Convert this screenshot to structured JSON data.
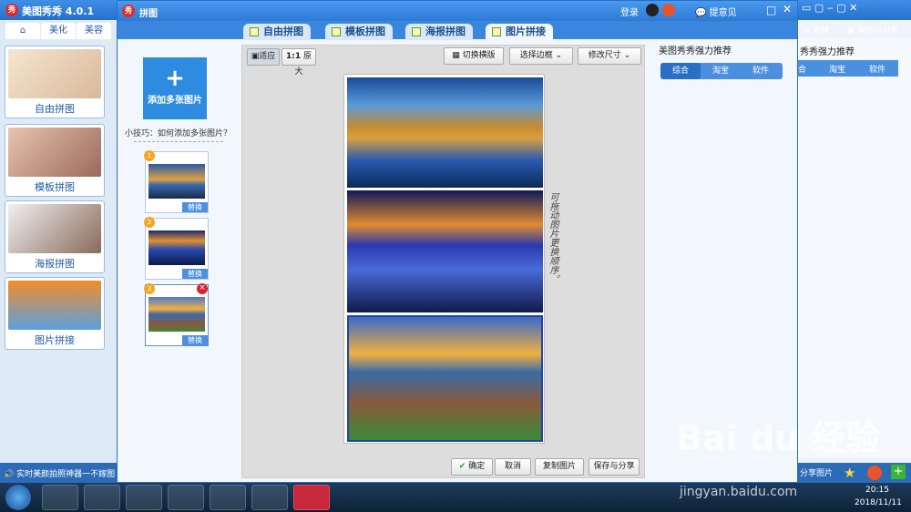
{
  "app": {
    "title": "美图秀秀 4.0.1",
    "sub_title": "拼图"
  },
  "left_tabs": [
    "美化",
    "美容"
  ],
  "left_cards": [
    {
      "label": "自由拼图"
    },
    {
      "label": "模板拼图"
    },
    {
      "label": "海报拼图"
    },
    {
      "label": "图片拼接"
    }
  ],
  "left_status": "实时美颜拍照神器一不嫁图",
  "header": {
    "login": "登录",
    "feedback": "提意见"
  },
  "tabs": [
    {
      "label": "自由拼图"
    },
    {
      "label": "模板拼图"
    },
    {
      "label": "海报拼图"
    },
    {
      "label": "图片拼接"
    }
  ],
  "left_panel": {
    "add_button": "添加多张图片",
    "tip": "小技巧：如何添加多张图片？",
    "replace_label": "替换",
    "thumbs": [
      "1",
      "2",
      "3"
    ]
  },
  "toolbar": {
    "fit": "适应",
    "original_ratio": "1:1",
    "original": "原大",
    "switch": "切换横版",
    "border": "选择边框",
    "resize": "修改尺寸"
  },
  "hint": "可拖动图片更换顺序。",
  "bottom_buttons": {
    "ok": "确定",
    "cancel": "取消",
    "copy": "复制图片",
    "save_share": "保存与分享"
  },
  "recommend": {
    "title": "美图秀秀强力推荐",
    "tabs": [
      "综合",
      "淘宝",
      "软件"
    ]
  },
  "right_panel": {
    "new": "新建",
    "save_share": "保存与分享",
    "title": "秀秀强力推荐",
    "tabs": [
      "合",
      "淘宝",
      "软件"
    ],
    "bottom": "分享图片"
  },
  "taskbar": {
    "time": "20:15",
    "date": "2018/11/11"
  },
  "watermark": {
    "logo": "Bai du 经验",
    "url": "jingyan.baidu.com"
  }
}
